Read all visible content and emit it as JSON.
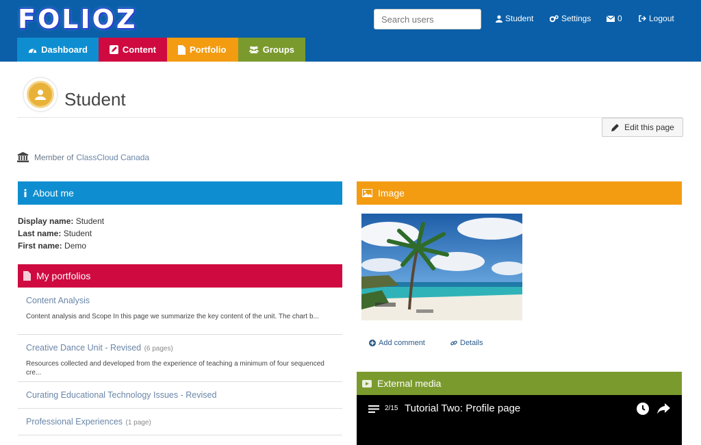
{
  "header": {
    "logo": "FOLIOZ",
    "search_placeholder": "Search users",
    "user_label": "Student",
    "settings_label": "Settings",
    "messages_count": "0",
    "logout_label": "Logout"
  },
  "tabs": [
    {
      "label": "Dashboard",
      "color": "#0e8ed0"
    },
    {
      "label": "Content",
      "color": "#cf0a40"
    },
    {
      "label": "Portfolio",
      "color": "#f39c12"
    },
    {
      "label": "Groups",
      "color": "#7b9a2e"
    }
  ],
  "page": {
    "title": "Student",
    "edit_label": "Edit this page",
    "member_prefix": "Member of",
    "member_group": "ClassCloud Canada"
  },
  "about": {
    "heading": "About me",
    "fields": [
      {
        "label": "Display name:",
        "value": "Student"
      },
      {
        "label": "Last name:",
        "value": "Student"
      },
      {
        "label": "First name:",
        "value": "Demo"
      }
    ]
  },
  "portfolios": {
    "heading": "My portfolios",
    "items": [
      {
        "title": "Content Analysis",
        "count": "",
        "desc": "Content analysis and Scope In this page we summarize the key content of the unit.  The chart b..."
      },
      {
        "title": "Creative Dance Unit - Revised",
        "count": "(6 pages)",
        "desc": "Resources collected and developed from the experience of teaching a minimum of four sequenced cre..."
      },
      {
        "title": "Curating Educational Technology Issues - Revised",
        "count": "",
        "desc": ""
      },
      {
        "title": "Professional Experiences",
        "count": "(1 page)",
        "desc": ""
      }
    ]
  },
  "image_block": {
    "heading": "Image",
    "add_comment": "Add comment",
    "details": "Details"
  },
  "media": {
    "heading": "External media",
    "playlist_count": "2/15",
    "video_title": "Tutorial Two: Profile page"
  }
}
